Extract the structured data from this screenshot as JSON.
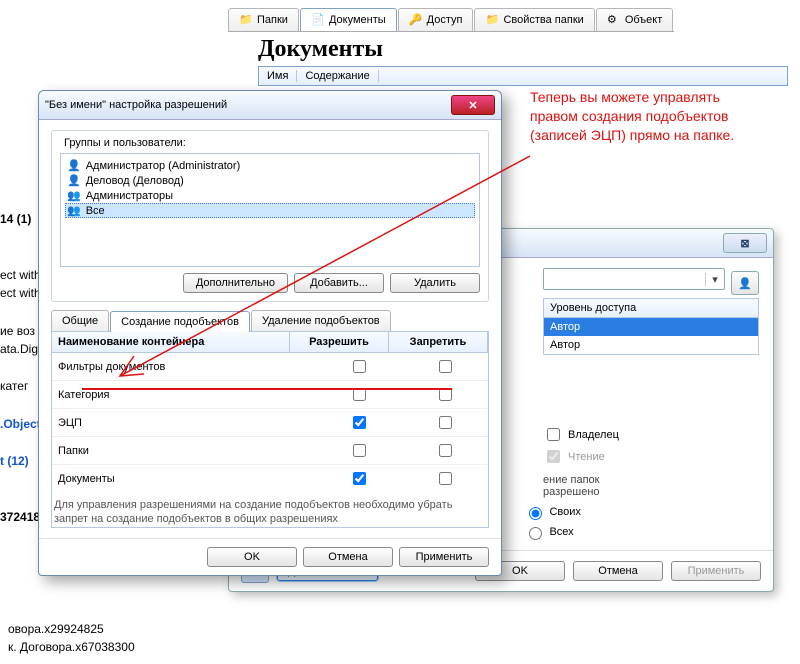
{
  "toolbar": {
    "tabs": [
      "Папки",
      "Документы",
      "Доступ",
      "Свойства папки",
      "Объект"
    ],
    "selected": 1
  },
  "header": {
    "title": "Документы",
    "columns": [
      "Имя",
      "Содержание"
    ]
  },
  "annotation": {
    "text": "Теперь вы можете управлять правом создания подобъектов (записей ЭЦП) прямо на папке."
  },
  "dialog": {
    "title": "\"Без имени\" настройка разрешений",
    "groups_label": "Группы и пользователи:",
    "users": [
      {
        "name": "Администратор (Administrator)",
        "type": "user"
      },
      {
        "name": "Деловод (Деловод)",
        "type": "user"
      },
      {
        "name": "Администраторы",
        "type": "group"
      },
      {
        "name": "Все",
        "type": "group",
        "selected": true
      }
    ],
    "btns": {
      "adv": "Дополнительно",
      "add": "Добавить...",
      "del": "Удалить"
    },
    "tabs": [
      "Общие",
      "Создание подобъектов",
      "Удаление подобъектов"
    ],
    "tab_selected": 1,
    "table": {
      "head": [
        "Наименование контейнера",
        "Разрешить",
        "Запретить"
      ],
      "rows": [
        {
          "name": "Фильтры документов",
          "allow": false,
          "deny": false
        },
        {
          "name": "Категория",
          "allow": false,
          "deny": false
        },
        {
          "name": "ЭЦП",
          "allow": true,
          "deny": false,
          "hl": true
        },
        {
          "name": "Папки",
          "allow": false,
          "deny": false
        },
        {
          "name": "Документы",
          "allow": true,
          "deny": false
        }
      ]
    },
    "hint": "Для управления разрешениями на создание подобъектов необходимо убрать запрет на создание подобъектов в общих разрешениях",
    "foot": {
      "ok": "OK",
      "cancel": "Отмена",
      "apply": "Применить"
    }
  },
  "access": {
    "list_head": "Уровень доступа",
    "items": [
      "Автор",
      "Автор"
    ],
    "selected": 0,
    "owner": "Владелец",
    "read": "Чтение",
    "folders_tail": "ение папок",
    "allowed_tail": "разрешено",
    "radios": [
      "Своих",
      "Всех"
    ],
    "btns": {
      "more": "Дополнительно",
      "ok": "OK",
      "cancel": "Отмена",
      "apply": "Применить"
    }
  },
  "left": {
    "l1": "14  (1)",
    "l2": "ect with",
    "l3": "ect with",
    "l4": "ие воз",
    "l5": "ata.Digit",
    "l6": "катег",
    "l7": ".Object",
    "l8": "t  (12)",
    "l9": "372418"
  },
  "bottom": {
    "b1": "овора.x29924825",
    "b2": "к. Договора.x67038300"
  }
}
